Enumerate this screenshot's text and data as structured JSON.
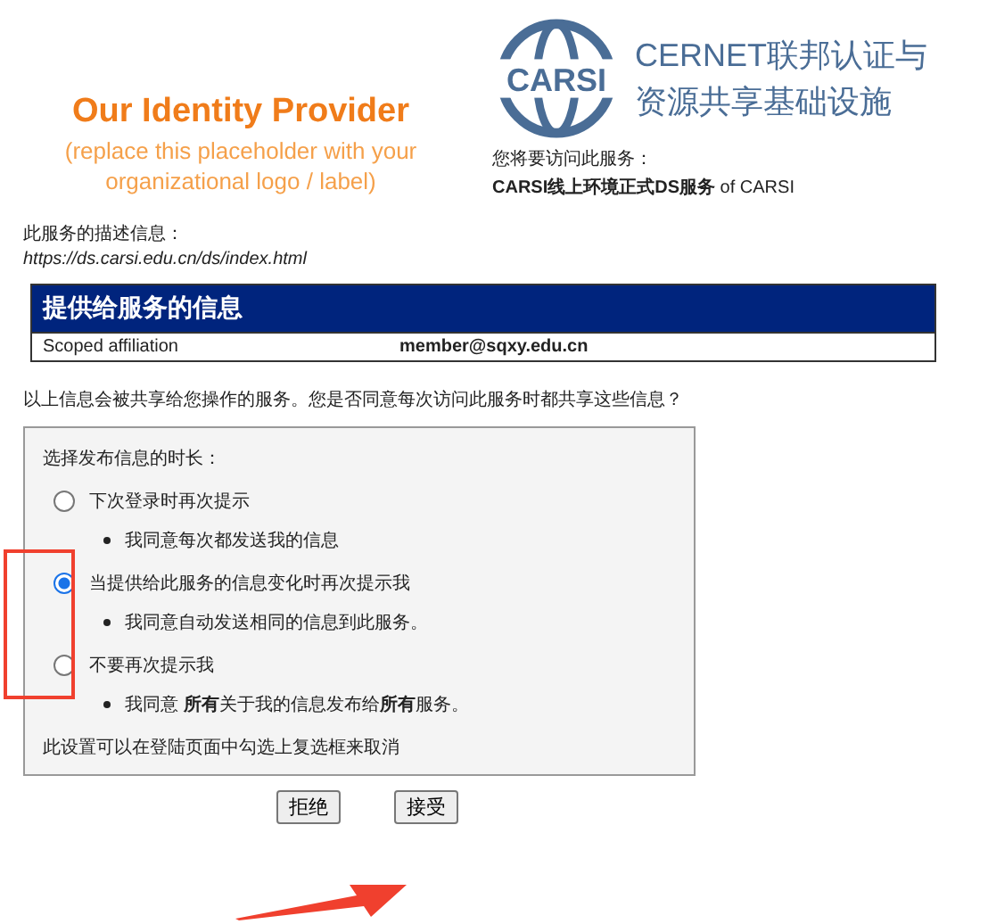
{
  "header": {
    "idp_title": "Our Identity Provider",
    "idp_subtitle": "(replace this placeholder with your organizational logo / label)",
    "logo_text": "CARSI",
    "logo_caption_lines": [
      "CERNET联邦认证与",
      "资源共享基础设施"
    ],
    "visit_label": "您将要访问此服务：",
    "service_name": "**CARSI线上环境正式DS服务** of CARSI"
  },
  "description": {
    "label": "此服务的描述信息：",
    "url": "https://ds.carsi.edu.cn/ds/index.html"
  },
  "table": {
    "title": "提供给服务的信息",
    "rows": [
      {
        "name": "Scoped affiliation",
        "value": "member@sqxy.edu.cn"
      }
    ]
  },
  "question": "以上信息会被共享给您操作的服务。您是否同意每次访问此服务时都共享这些信息？",
  "options_box": {
    "title": "选择发布信息的时长：",
    "options": [
      {
        "label": "下次登录时再次提示",
        "note": "我同意每次都发送我的信息",
        "selected": false
      },
      {
        "label": "当提供给此服务的信息变化时再次提示我",
        "note": "我同意自动发送相同的信息到此服务。",
        "selected": true
      },
      {
        "label": "不要再次提示我",
        "note": "我同意 **所有**关于我的信息发布给**所有**服务。",
        "selected": false
      }
    ],
    "footer": "此设置可以在登陆页面中勾选上复选框来取消"
  },
  "buttons": [
    "拒绝",
    "接受"
  ]
}
